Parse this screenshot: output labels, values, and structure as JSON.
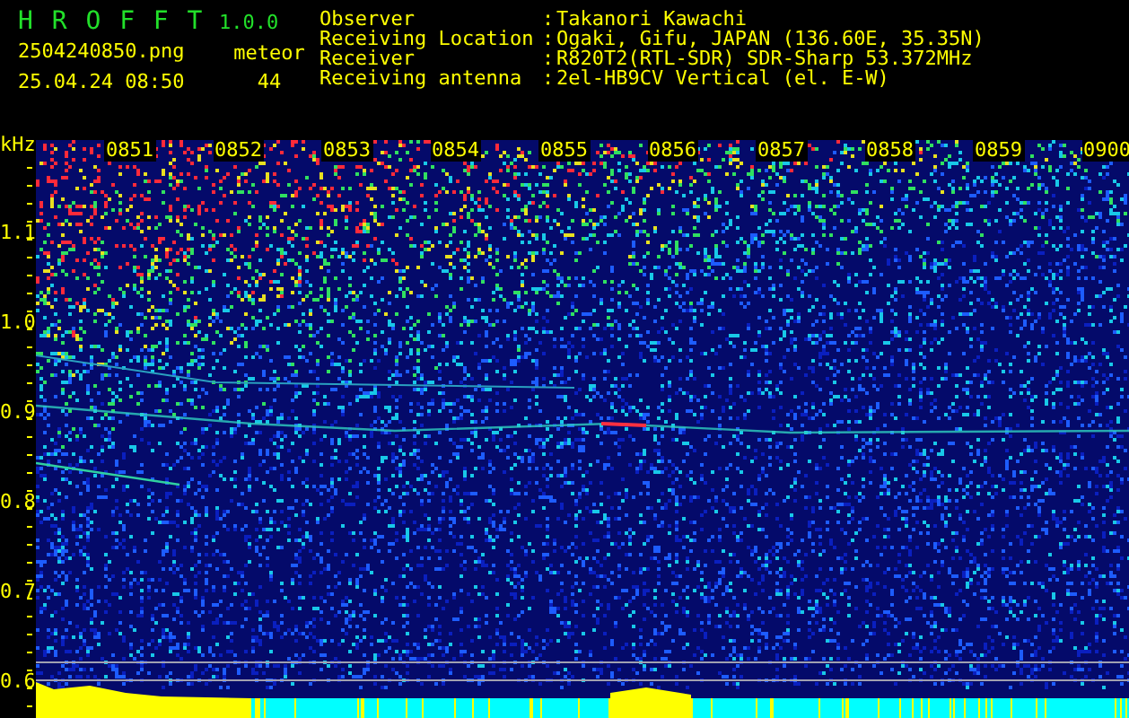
{
  "app": {
    "name": "H R O F F T",
    "version": "1.0.0"
  },
  "file": {
    "name": "2504240850.png",
    "timestamp": "25.04.24 08:50"
  },
  "counter": {
    "label": "meteor",
    "value": "44"
  },
  "station_info": [
    {
      "label": "Observer",
      "separator": ":",
      "value": "Takanori Kawachi"
    },
    {
      "label": "Receiving Location",
      "separator": ":",
      "value": "Ogaki, Gifu, JAPAN (136.60E, 35.35N)"
    },
    {
      "label": "Receiver",
      "separator": ":",
      "value": "R820T2(RTL-SDR) SDR-Sharp 53.372MHz"
    },
    {
      "label": "Receiving antenna",
      "separator": ":",
      "value": "2el-HB9CV Vertical (el. E-W)"
    }
  ],
  "spectrogram": {
    "y_unit": "kHz",
    "y_labels": [
      "1.1",
      "1.0",
      "0.9",
      "0.8",
      "0.7",
      "0.6"
    ],
    "time_labels": [
      "0851",
      "0852",
      "0853",
      "0854",
      "0855",
      "0856",
      "0857",
      "0858",
      "0859",
      "0900"
    ]
  }
}
